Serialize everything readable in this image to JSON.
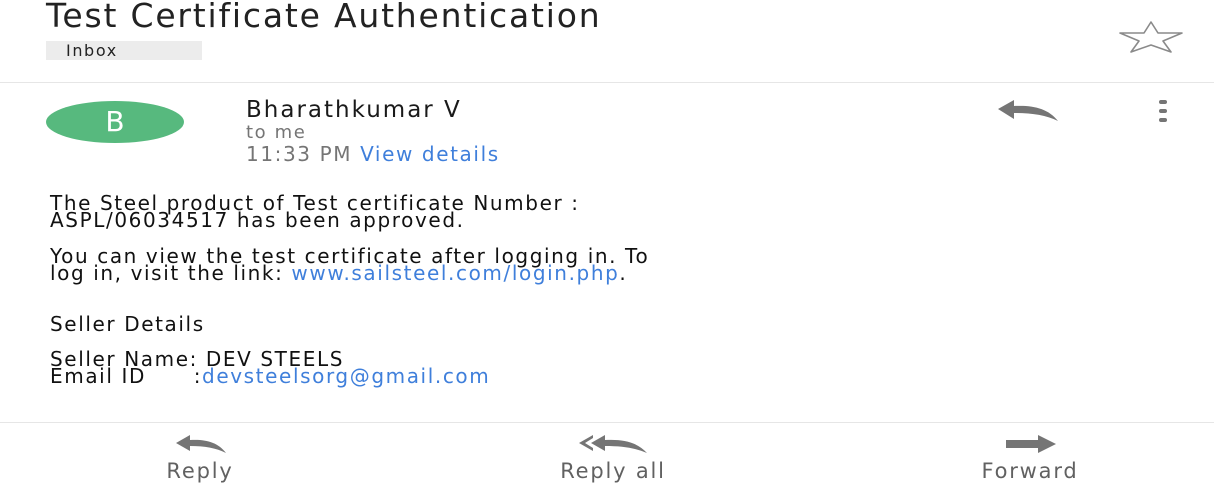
{
  "email": {
    "subject": "Test Certificate Authentication",
    "label": "Inbox",
    "sender": {
      "initial": "B",
      "name": "Bharathkumar V",
      "recipient": "to me",
      "time": "11:33 PM",
      "details_link": "View details"
    },
    "body": {
      "line1": "The Steel product of Test certificate Number :",
      "line2": "ASPL/06034517 has been approved.",
      "line3": "You can view the test certificate after logging in. To",
      "line4_prefix": "log in, visit the link: ",
      "line4_link": "www.sailsteel.com/login.php",
      "line4_suffix": ".",
      "section_heading": "Seller Details",
      "seller_name_line": "Seller Name: DEV STEELS",
      "email_label": "Email ID      :",
      "email_value": "devsteelsorg@gmail.com"
    }
  },
  "actions": {
    "reply": "Reply",
    "reply_all": "Reply all",
    "forward": "Forward"
  },
  "icons": {
    "star": "star-outline-icon",
    "reply": "reply-icon",
    "reply_all": "reply-all-icon",
    "forward": "forward-icon",
    "more": "more-vertical-icon"
  },
  "colors": {
    "avatar": "#57b97e",
    "link": "#3f7fdb",
    "secondary_text": "#757575",
    "icon_gray": "#757575",
    "label_chip": "#ececec"
  }
}
